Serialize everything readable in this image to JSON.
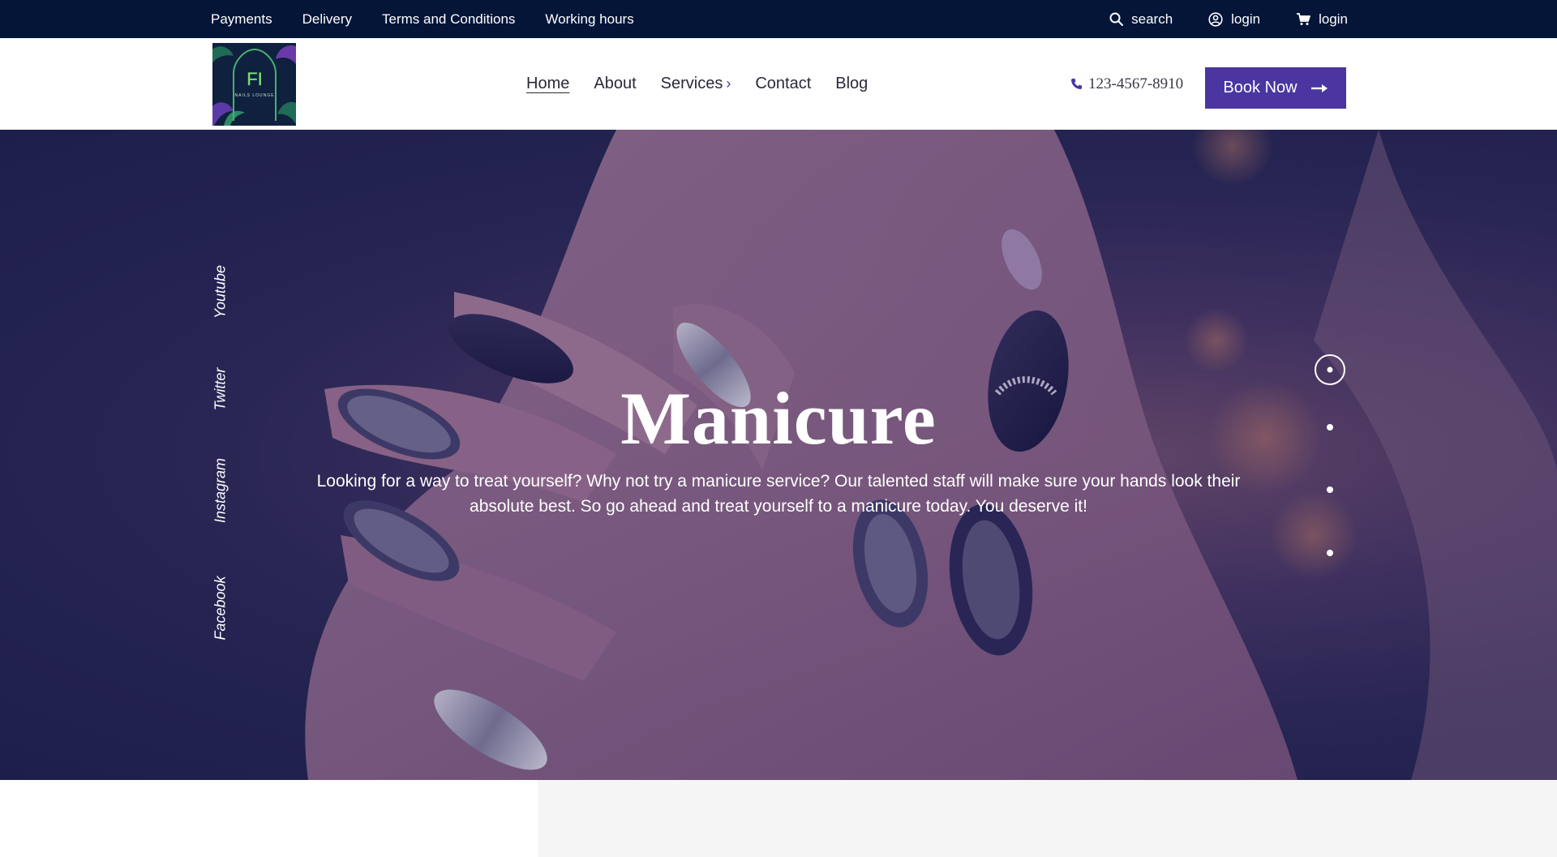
{
  "topbar": {
    "links": [
      "Payments",
      "Delivery",
      "Terms and Conditions",
      "Working hours"
    ],
    "search_label": "search",
    "account_label": "login",
    "cart_label": "login"
  },
  "header": {
    "nav": {
      "home": "Home",
      "about": "About",
      "services": "Services",
      "contact": "Contact",
      "blog": "Blog"
    },
    "phone": "123-4567-8910",
    "book_label": "Book Now"
  },
  "hero": {
    "title": "Manicure",
    "text": "Looking for a way to treat yourself? Why not try a manicure service? Our talented staff will make sure your hands look their absolute best. So go ahead and treat yourself to a manicure today. You deserve it!",
    "social": {
      "youtube": "Youtube",
      "twitter": "Twitter",
      "instagram": "Instagram",
      "facebook": "Facebook"
    },
    "slides_total": 4,
    "active_slide": 1
  },
  "colors": {
    "topbar_bg": "#041538",
    "accent": "#4b35a0",
    "hero_overlay": "#2b2a55"
  }
}
